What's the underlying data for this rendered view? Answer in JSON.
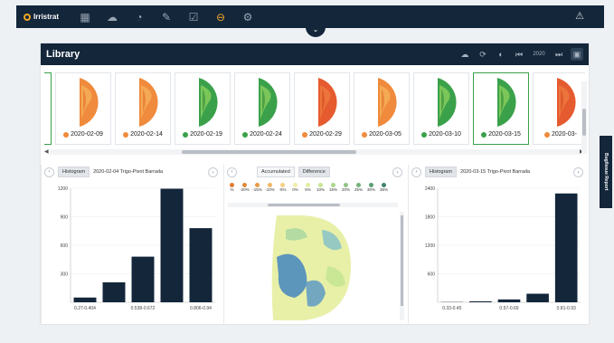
{
  "app": {
    "brand": "Irristrat"
  },
  "nav": {
    "icons": [
      "calendar-icon",
      "weather-icon",
      "gauge-icon",
      "edit-icon",
      "clipboard-icon",
      "toggle-icon",
      "gear-icon"
    ],
    "active_index": 5,
    "alert_icon": "warning-icon",
    "collapse_icon": "chevron-down-icon"
  },
  "library": {
    "title": "Library",
    "tools": [
      "cloud-icon",
      "refresh-icon",
      "contrast-icon",
      "first-icon",
      "2020",
      "last-icon",
      "fullscreen-icon"
    ],
    "year_label": "2020",
    "thumbnails": [
      {
        "date": "2020-02-09",
        "status": "orange",
        "tone": "orange"
      },
      {
        "date": "2020-02-14",
        "status": "orange",
        "tone": "orange"
      },
      {
        "date": "2020-02-19",
        "status": "green",
        "tone": "green"
      },
      {
        "date": "2020-02-24",
        "status": "green",
        "tone": "green"
      },
      {
        "date": "2020-02-29",
        "status": "orange",
        "tone": "red"
      },
      {
        "date": "2020-03-05",
        "status": "orange",
        "tone": "orange"
      },
      {
        "date": "2020-03-10",
        "status": "green",
        "tone": "green"
      },
      {
        "date": "2020-03-15",
        "status": "green",
        "tone": "green",
        "selected": true
      },
      {
        "date": "2020-03-",
        "status": "orange",
        "tone": "red"
      }
    ]
  },
  "left_panel": {
    "tab": "Histogram",
    "title": "2020-02-04 Trigo-Pivot Barrada"
  },
  "middle_panel": {
    "tabs": [
      "Accumulated",
      "Difference"
    ],
    "active_tab": "Difference",
    "legend": [
      {
        "label": "%",
        "color": "#e07b2e"
      },
      {
        "label": "-20%",
        "color": "#e08a35"
      },
      {
        "label": "-15%",
        "color": "#e99b46"
      },
      {
        "label": "-10%",
        "color": "#efb663"
      },
      {
        "label": "-5%",
        "color": "#f3d184"
      },
      {
        "label": "0%",
        "color": "#f4ecac"
      },
      {
        "label": "5%",
        "color": "#e2ef9f"
      },
      {
        "label": "10%",
        "color": "#c6e593"
      },
      {
        "label": "15%",
        "color": "#a9d88a"
      },
      {
        "label": "20%",
        "color": "#8ec784"
      },
      {
        "label": "25%",
        "color": "#74b27c"
      },
      {
        "label": "30%",
        "color": "#5a9c74"
      },
      {
        "label": "35%",
        "color": "#3f846b"
      }
    ]
  },
  "right_panel": {
    "tab": "Histogram",
    "title": "2020-03-15 Trigo-Pivot Barrada"
  },
  "side_tab": {
    "label": "Bug/Issue Report"
  },
  "chart_data": [
    {
      "type": "bar",
      "title": "",
      "categories": [
        "0.27-0.404",
        "",
        "0.538-0.672",
        "",
        "0.806-0.94"
      ],
      "values": [
        50,
        210,
        480,
        1195,
        780
      ],
      "ylim": [
        0,
        1200
      ],
      "yticks": [
        300,
        600,
        900,
        1200
      ],
      "color": "#13263a"
    },
    {
      "type": "bar",
      "title": "",
      "categories": [
        "0.33-0.45",
        "",
        "0.57-0.69",
        "",
        "0.81-0.93"
      ],
      "values": [
        5,
        20,
        60,
        180,
        2290
      ],
      "ylim": [
        0,
        2400
      ],
      "yticks": [
        600,
        1200,
        1800,
        2400
      ],
      "color": "#13263a"
    }
  ]
}
